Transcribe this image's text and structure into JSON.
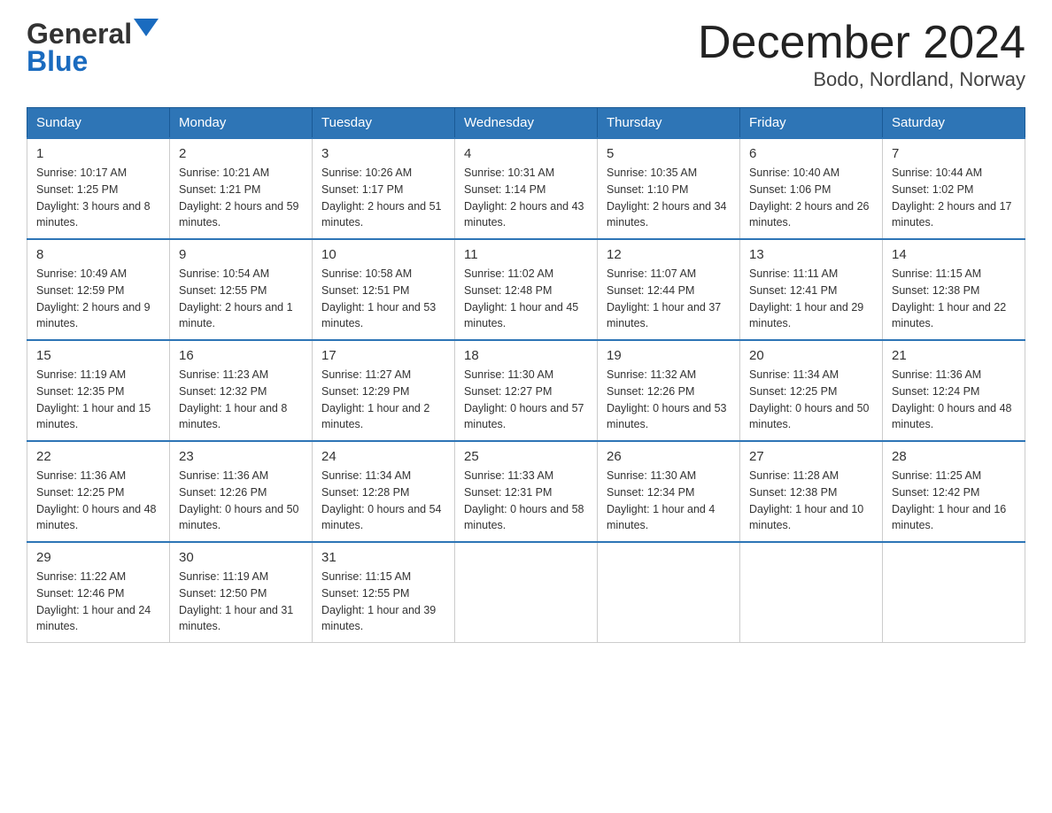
{
  "header": {
    "logo_general": "General",
    "logo_blue": "Blue",
    "title": "December 2024",
    "subtitle": "Bodo, Nordland, Norway"
  },
  "days_of_week": [
    "Sunday",
    "Monday",
    "Tuesday",
    "Wednesday",
    "Thursday",
    "Friday",
    "Saturday"
  ],
  "weeks": [
    [
      {
        "day": "1",
        "sunrise": "10:17 AM",
        "sunset": "1:25 PM",
        "daylight": "3 hours and 8 minutes."
      },
      {
        "day": "2",
        "sunrise": "10:21 AM",
        "sunset": "1:21 PM",
        "daylight": "2 hours and 59 minutes."
      },
      {
        "day": "3",
        "sunrise": "10:26 AM",
        "sunset": "1:17 PM",
        "daylight": "2 hours and 51 minutes."
      },
      {
        "day": "4",
        "sunrise": "10:31 AM",
        "sunset": "1:14 PM",
        "daylight": "2 hours and 43 minutes."
      },
      {
        "day": "5",
        "sunrise": "10:35 AM",
        "sunset": "1:10 PM",
        "daylight": "2 hours and 34 minutes."
      },
      {
        "day": "6",
        "sunrise": "10:40 AM",
        "sunset": "1:06 PM",
        "daylight": "2 hours and 26 minutes."
      },
      {
        "day": "7",
        "sunrise": "10:44 AM",
        "sunset": "1:02 PM",
        "daylight": "2 hours and 17 minutes."
      }
    ],
    [
      {
        "day": "8",
        "sunrise": "10:49 AM",
        "sunset": "12:59 PM",
        "daylight": "2 hours and 9 minutes."
      },
      {
        "day": "9",
        "sunrise": "10:54 AM",
        "sunset": "12:55 PM",
        "daylight": "2 hours and 1 minute."
      },
      {
        "day": "10",
        "sunrise": "10:58 AM",
        "sunset": "12:51 PM",
        "daylight": "1 hour and 53 minutes."
      },
      {
        "day": "11",
        "sunrise": "11:02 AM",
        "sunset": "12:48 PM",
        "daylight": "1 hour and 45 minutes."
      },
      {
        "day": "12",
        "sunrise": "11:07 AM",
        "sunset": "12:44 PM",
        "daylight": "1 hour and 37 minutes."
      },
      {
        "day": "13",
        "sunrise": "11:11 AM",
        "sunset": "12:41 PM",
        "daylight": "1 hour and 29 minutes."
      },
      {
        "day": "14",
        "sunrise": "11:15 AM",
        "sunset": "12:38 PM",
        "daylight": "1 hour and 22 minutes."
      }
    ],
    [
      {
        "day": "15",
        "sunrise": "11:19 AM",
        "sunset": "12:35 PM",
        "daylight": "1 hour and 15 minutes."
      },
      {
        "day": "16",
        "sunrise": "11:23 AM",
        "sunset": "12:32 PM",
        "daylight": "1 hour and 8 minutes."
      },
      {
        "day": "17",
        "sunrise": "11:27 AM",
        "sunset": "12:29 PM",
        "daylight": "1 hour and 2 minutes."
      },
      {
        "day": "18",
        "sunrise": "11:30 AM",
        "sunset": "12:27 PM",
        "daylight": "0 hours and 57 minutes."
      },
      {
        "day": "19",
        "sunrise": "11:32 AM",
        "sunset": "12:26 PM",
        "daylight": "0 hours and 53 minutes."
      },
      {
        "day": "20",
        "sunrise": "11:34 AM",
        "sunset": "12:25 PM",
        "daylight": "0 hours and 50 minutes."
      },
      {
        "day": "21",
        "sunrise": "11:36 AM",
        "sunset": "12:24 PM",
        "daylight": "0 hours and 48 minutes."
      }
    ],
    [
      {
        "day": "22",
        "sunrise": "11:36 AM",
        "sunset": "12:25 PM",
        "daylight": "0 hours and 48 minutes."
      },
      {
        "day": "23",
        "sunrise": "11:36 AM",
        "sunset": "12:26 PM",
        "daylight": "0 hours and 50 minutes."
      },
      {
        "day": "24",
        "sunrise": "11:34 AM",
        "sunset": "12:28 PM",
        "daylight": "0 hours and 54 minutes."
      },
      {
        "day": "25",
        "sunrise": "11:33 AM",
        "sunset": "12:31 PM",
        "daylight": "0 hours and 58 minutes."
      },
      {
        "day": "26",
        "sunrise": "11:30 AM",
        "sunset": "12:34 PM",
        "daylight": "1 hour and 4 minutes."
      },
      {
        "day": "27",
        "sunrise": "11:28 AM",
        "sunset": "12:38 PM",
        "daylight": "1 hour and 10 minutes."
      },
      {
        "day": "28",
        "sunrise": "11:25 AM",
        "sunset": "12:42 PM",
        "daylight": "1 hour and 16 minutes."
      }
    ],
    [
      {
        "day": "29",
        "sunrise": "11:22 AM",
        "sunset": "12:46 PM",
        "daylight": "1 hour and 24 minutes."
      },
      {
        "day": "30",
        "sunrise": "11:19 AM",
        "sunset": "12:50 PM",
        "daylight": "1 hour and 31 minutes."
      },
      {
        "day": "31",
        "sunrise": "11:15 AM",
        "sunset": "12:55 PM",
        "daylight": "1 hour and 39 minutes."
      },
      null,
      null,
      null,
      null
    ]
  ]
}
